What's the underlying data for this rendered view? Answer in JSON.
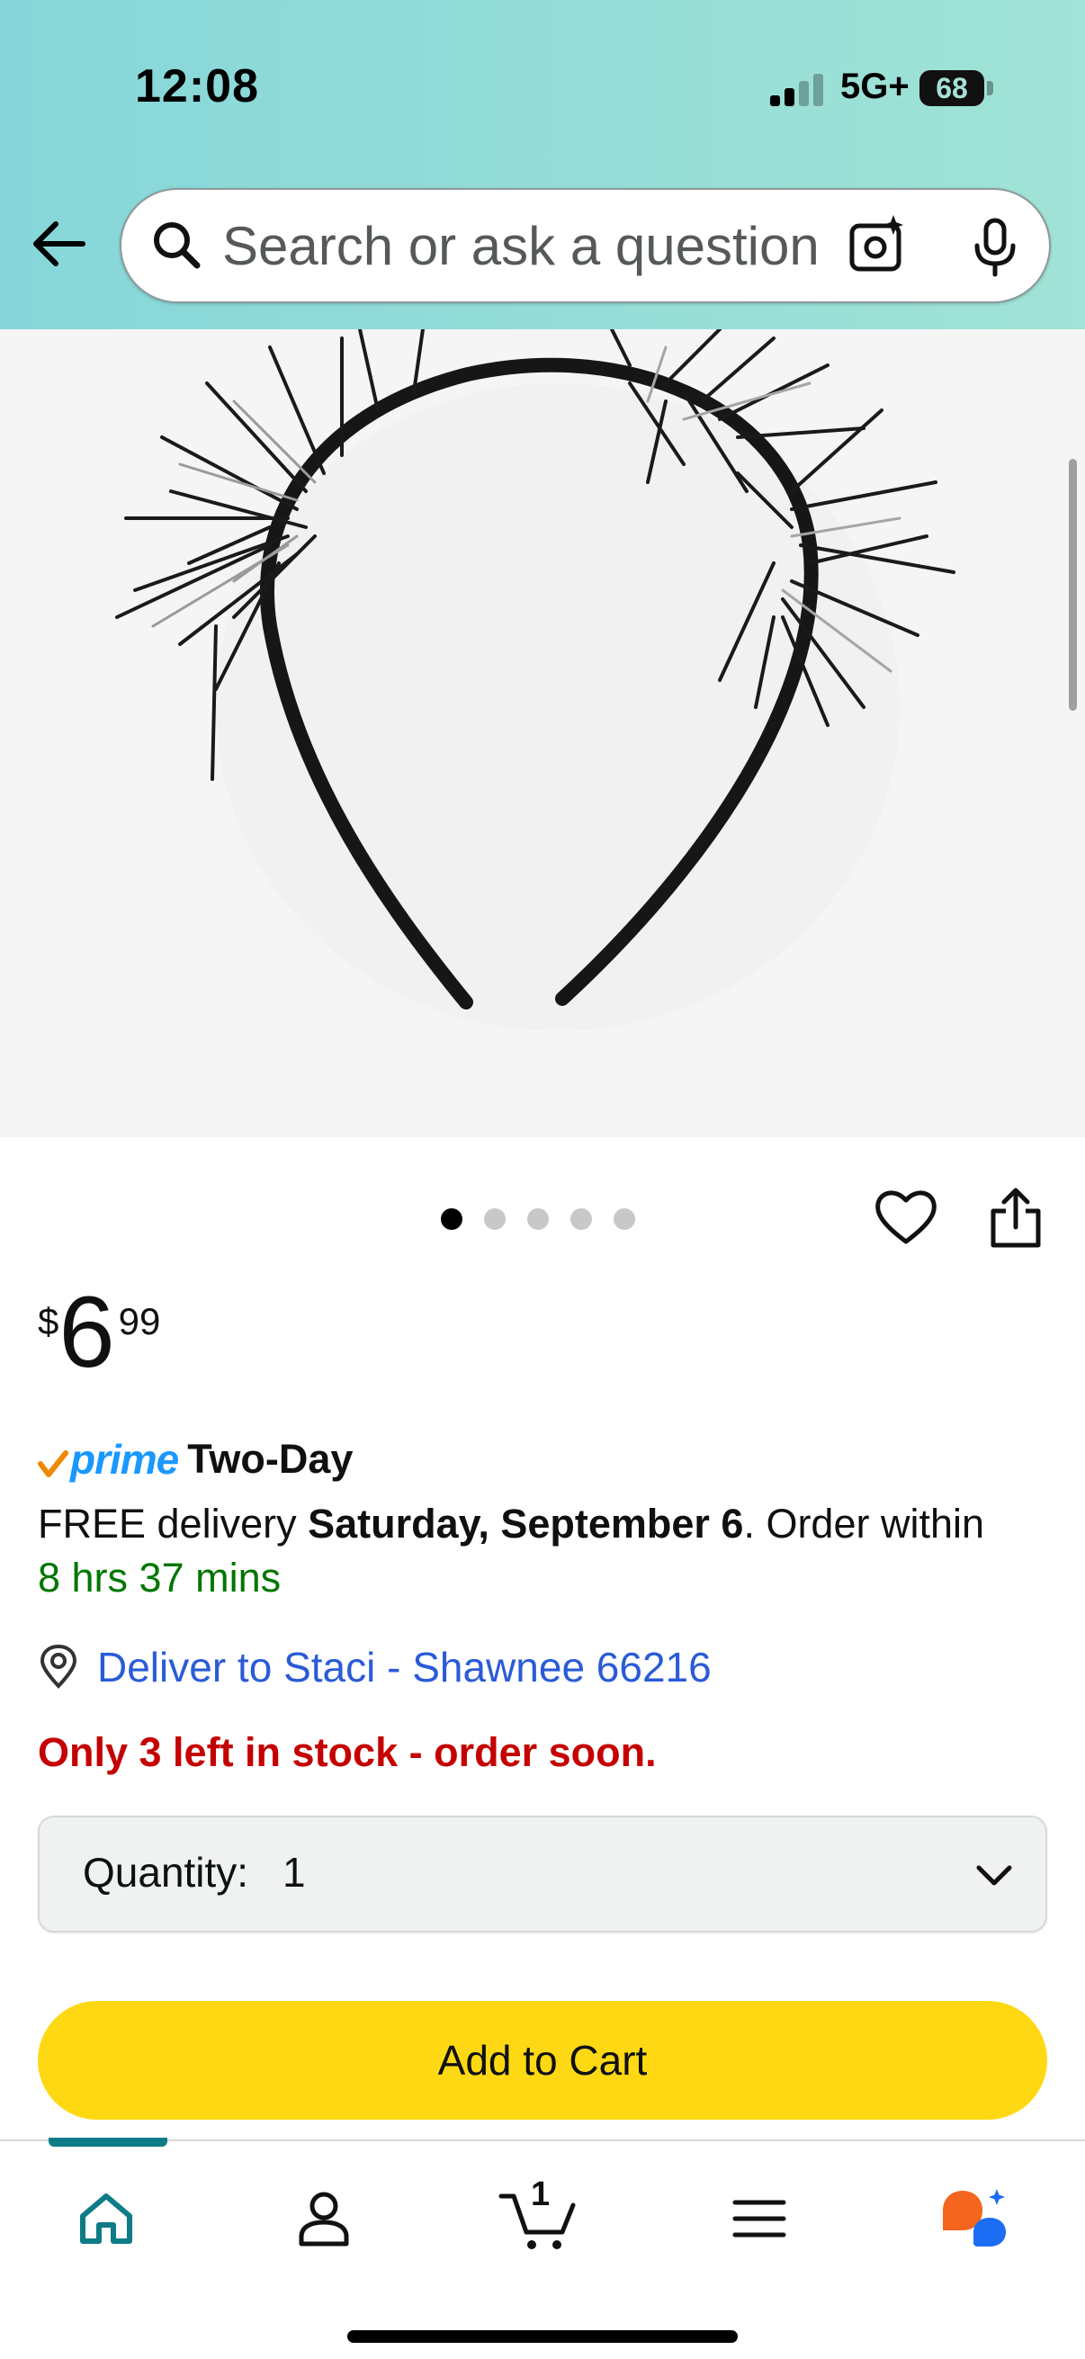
{
  "status_bar": {
    "time": "12:08",
    "network": "5G+",
    "battery": "68"
  },
  "header": {
    "search_placeholder": "Search or ask a question",
    "icons": [
      "back-arrow-icon",
      "search-icon",
      "camera-lens-icon",
      "microphone-icon"
    ]
  },
  "gallery": {
    "image_count": 5,
    "active_index": 0,
    "image_description_icon": "product-image"
  },
  "price": {
    "symbol": "$",
    "whole": "6",
    "fraction": "99"
  },
  "prime": {
    "brand": "prime",
    "speed": "Two-Day"
  },
  "delivery": {
    "prefix": "FREE delivery ",
    "date": "Saturday, September 6",
    "suffix": ". Order within",
    "countdown": "8 hrs 37 mins"
  },
  "deliver_to": {
    "label": "Deliver to Staci - Shawnee 66216"
  },
  "stock": {
    "message": "Only 3 left in stock - order soon."
  },
  "quantity": {
    "label": "Quantity:",
    "value": "1"
  },
  "actions": {
    "add_to_cart": "Add to Cart"
  },
  "bottom_nav": {
    "cart_count": "1",
    "items": [
      "home-icon",
      "account-icon",
      "cart-icon",
      "menu-icon",
      "rufus-icon"
    ],
    "active": "home"
  },
  "colors": {
    "header_gradient_start": "#86d6d9",
    "header_gradient_end": "#a1e3d6",
    "add_to_cart": "#ffd814",
    "stock_warning": "#c40000",
    "countdown": "#007600",
    "link": "#2a5bd7",
    "prime_blue": "#1a98ff",
    "prime_check": "#f08804",
    "nav_active": "#0e7c86",
    "rufus_orange": "#f4651d",
    "rufus_blue": "#1b6ef3"
  }
}
